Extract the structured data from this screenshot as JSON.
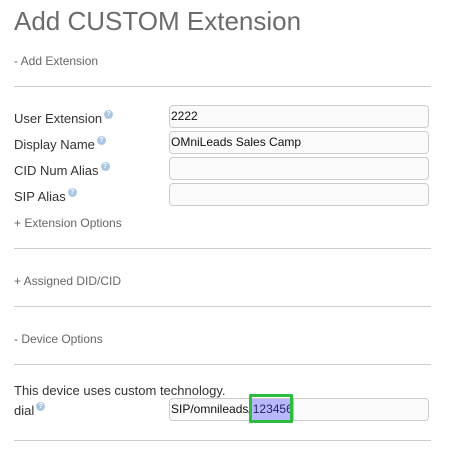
{
  "page": {
    "title": "Add CUSTOM Extension"
  },
  "sections": {
    "add_extension": "- Add Extension",
    "extension_options": "+ Extension Options",
    "assigned_did": "+ Assigned DID/CID",
    "device_options": "- Device Options"
  },
  "fields": {
    "user_extension": {
      "label": "User Extension",
      "value": "2222"
    },
    "display_name": {
      "label": "Display Name",
      "value": "OMniLeads Sales Camp"
    },
    "cid_num_alias": {
      "label": "CID Num Alias",
      "value": ""
    },
    "sip_alias": {
      "label": "SIP Alias",
      "value": ""
    }
  },
  "device": {
    "note": "This device uses custom technology.",
    "dial_label": "dial",
    "dial_prefix": "SIP/omnileads/",
    "dial_selected": "123456"
  },
  "icons": {
    "help": "question-circle-icon"
  },
  "colors": {
    "highlight": "#b9b8ff",
    "focus_box": "#2cbc3e",
    "help_icon": "#a9c6e3"
  }
}
